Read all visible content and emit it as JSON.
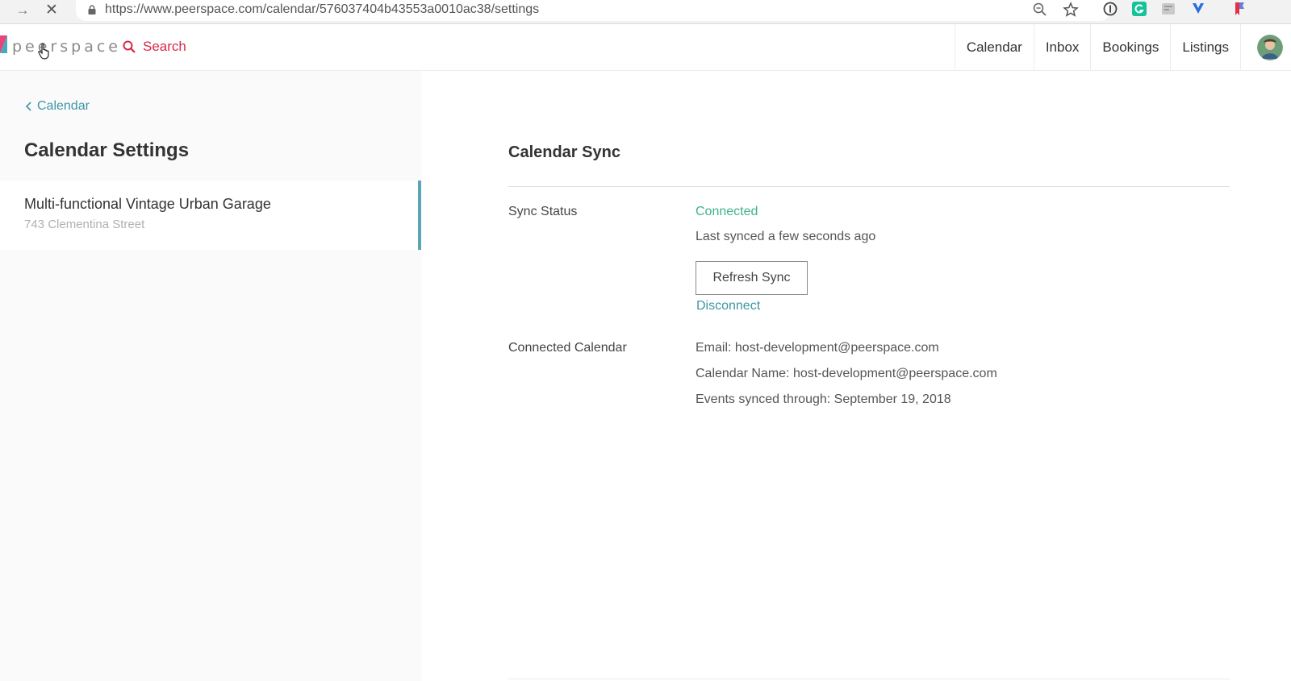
{
  "browser": {
    "url": "https://www.peerspace.com/calendar/576037404b43553a0010ac38/settings"
  },
  "header": {
    "logo_text": "peerspace",
    "search_label": "Search",
    "nav": [
      "Calendar",
      "Inbox",
      "Bookings",
      "Listings"
    ]
  },
  "sidebar": {
    "back_label": "Calendar",
    "title": "Calendar Settings",
    "listing": {
      "name": "Multi-functional Vintage Urban Garage",
      "address": "743 Clementina Street"
    }
  },
  "main": {
    "section_title": "Calendar Sync",
    "sync_status": {
      "label": "Sync Status",
      "status": "Connected",
      "last_synced": "Last synced a few seconds ago",
      "refresh_label": "Refresh Sync",
      "disconnect_label": "Disconnect"
    },
    "connected_calendar": {
      "label": "Connected Calendar",
      "email": "Email: host-development@peerspace.com",
      "calendar_name": "Calendar Name: host-development@peerspace.com",
      "events_synced": "Events synced through: September 19, 2018"
    }
  },
  "colors": {
    "accent_teal": "#3e96a6",
    "status_green": "#3fb08d",
    "search_red": "#d8274b",
    "active_border": "#5aa6b3"
  },
  "icons": [
    "forward-arrow-icon",
    "stop-icon",
    "lock-icon",
    "zoom-icon",
    "star-icon",
    "search-icon",
    "chevron-left-icon",
    "hand-cursor-icon"
  ]
}
